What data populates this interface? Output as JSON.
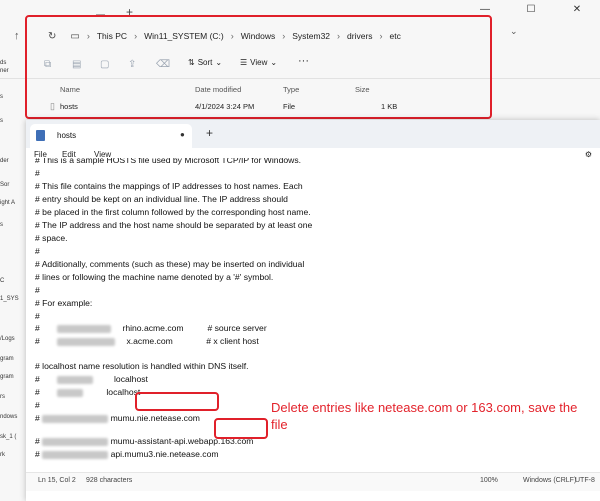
{
  "explorer": {
    "tab_close": "—",
    "breadcrumb": [
      "This PC",
      "Win11_SYSTEM (C:)",
      "Windows",
      "System32",
      "drivers",
      "etc"
    ],
    "toolbar": {
      "sort_label": "Sort",
      "view_label": "View",
      "more_label": "···"
    },
    "columns": {
      "name": "Name",
      "date": "Date modified",
      "type": "Type",
      "size": "Size"
    },
    "file": {
      "name": "hosts",
      "date": "4/1/2024 3:24 PM",
      "type": "File",
      "size": "1 KB"
    },
    "sidebar": [
      "ds",
      "ner",
      "s",
      "s",
      "der",
      "Sor",
      "ight A",
      "s",
      "C",
      "1_SYS",
      "",
      "/Logs",
      "gram",
      "gram",
      "rs",
      "ndows",
      "sk_1 (",
      "rk"
    ]
  },
  "notepad": {
    "tab_title": "hosts",
    "menu": {
      "file": "File",
      "edit": "Edit",
      "view": "View"
    },
    "lines": [
      "# This is a sample HOSTS file used by Microsoft TCP/IP for Windows.",
      "#",
      "# This file contains the mappings of IP addresses to host names. Each",
      "# entry should be kept on an individual line. The IP address should",
      "# be placed in the first column followed by the corresponding host name.",
      "# The IP address and the host name should be separated by at least one",
      "# space.",
      "#",
      "# Additionally, comments (such as these) may be inserted on individual",
      "# lines or following the machine name denoted by a '#' symbol.",
      "#",
      "# For example:",
      "#",
      "rhino.acme.com          # source server",
      "x.acme.com              # x client host",
      "",
      "# localhost name resolution is handled within DNS itself.",
      "localhost",
      "localhost",
      "#",
      "mumu.nie.",
      "netease.com",
      "mumu-assistant-api.webapp.",
      "163.com",
      "api.mumu3.nie.netease.com"
    ],
    "status": {
      "position": "Ln 15, Col 2",
      "chars": "928 characters",
      "zoom": "100%",
      "eol": "Windows (CRLF)",
      "encoding": "UTF-8"
    }
  },
  "annotation": "Delete entries like netease.com or 163.com, save the file",
  "colors": {
    "highlight": "#e0202a",
    "annotation": "#e3232c"
  }
}
